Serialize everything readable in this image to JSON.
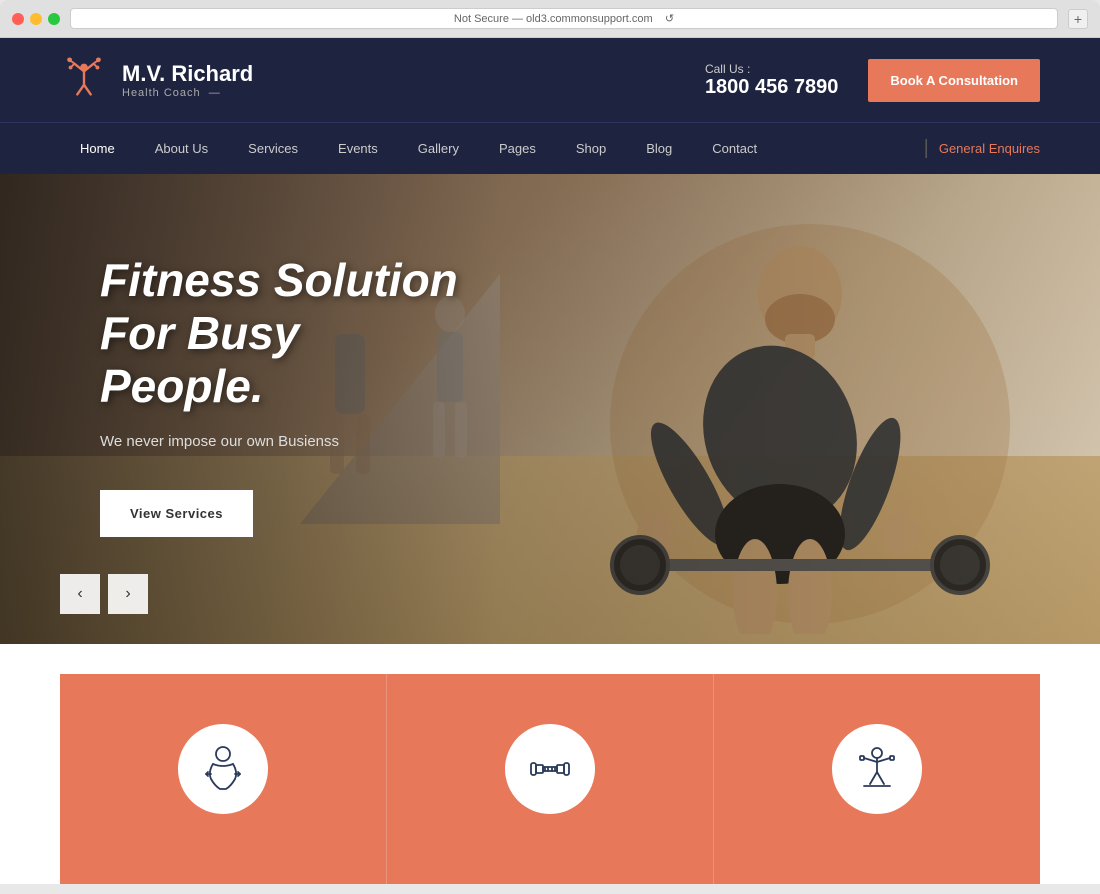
{
  "browser": {
    "address": "Not Secure — old3.commonsupport.com",
    "reload_icon": "↺"
  },
  "header": {
    "logo_name": "M.V. Richard",
    "logo_subtitle": "Health Coach",
    "logo_line": "—",
    "call_label": "Call Us :",
    "call_number": "1800 456 7890",
    "book_btn": "Book A Consultation"
  },
  "nav": {
    "items": [
      {
        "label": "Home",
        "active": true
      },
      {
        "label": "About Us"
      },
      {
        "label": "Services"
      },
      {
        "label": "Events"
      },
      {
        "label": "Gallery"
      },
      {
        "label": "Pages"
      },
      {
        "label": "Shop"
      },
      {
        "label": "Blog"
      },
      {
        "label": "Contact"
      }
    ],
    "enquiry": "General Enquires"
  },
  "hero": {
    "title": "Fitness Solution For Busy People.",
    "subtitle": "We never impose our own Busienss",
    "cta_btn": "View Services",
    "prev_arrow": "‹",
    "next_arrow": "›"
  },
  "services": {
    "cards": [
      {
        "icon": "body-shape-icon",
        "icon_unicode": "⊙"
      },
      {
        "icon": "dumbbell-icon",
        "icon_unicode": "⊕"
      },
      {
        "icon": "fitness-person-icon",
        "icon_unicode": "⊗"
      }
    ]
  },
  "colors": {
    "nav_bg": "#1e2340",
    "accent": "#e8785a",
    "white": "#ffffff"
  }
}
